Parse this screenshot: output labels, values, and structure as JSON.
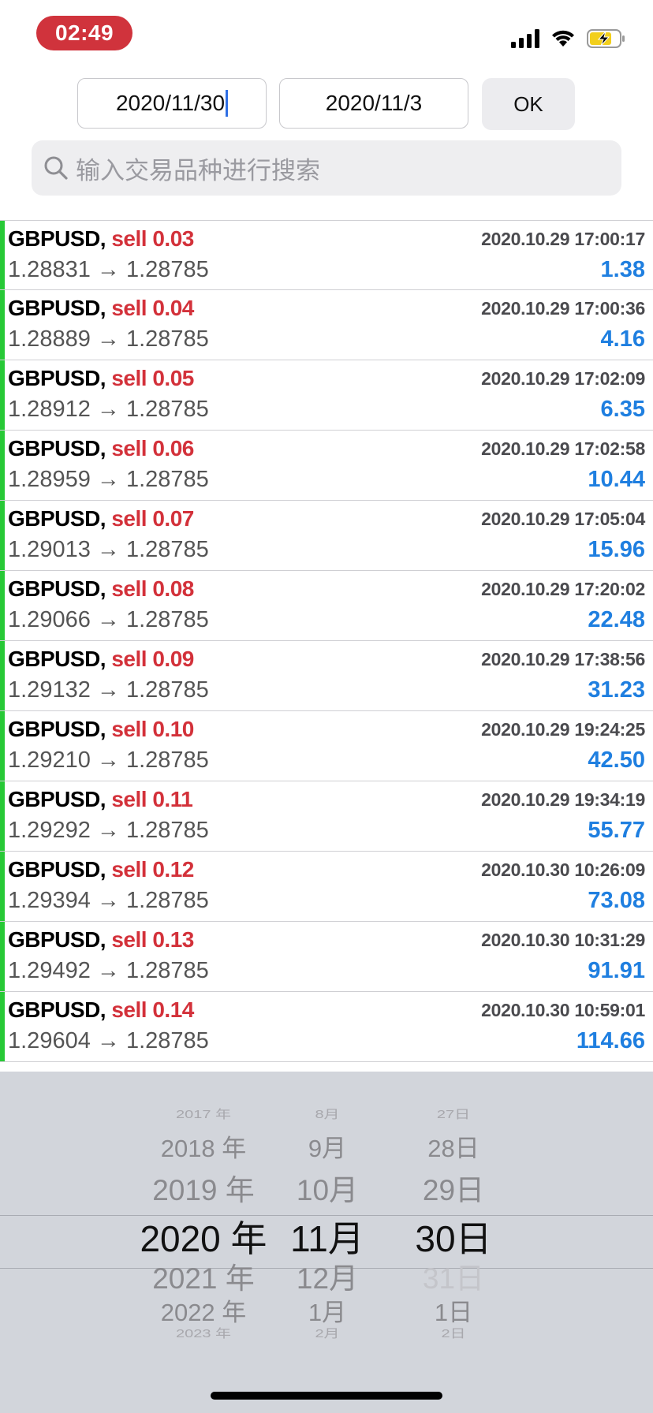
{
  "status_bar": {
    "time": "02:49"
  },
  "filter": {
    "start_date": "2020/11/30",
    "end_date": "2020/11/3",
    "ok_label": "OK",
    "search_placeholder": "输入交易品种进行搜索"
  },
  "trades": [
    {
      "symbol": "GBPUSD,",
      "action": "sell 0.03",
      "prices": "1.28831 → 1.28785",
      "time": "2020.10.29 17:00:17",
      "profit": "1.38"
    },
    {
      "symbol": "GBPUSD,",
      "action": "sell 0.04",
      "prices": "1.28889 → 1.28785",
      "time": "2020.10.29 17:00:36",
      "profit": "4.16"
    },
    {
      "symbol": "GBPUSD,",
      "action": "sell 0.05",
      "prices": "1.28912 → 1.28785",
      "time": "2020.10.29 17:02:09",
      "profit": "6.35"
    },
    {
      "symbol": "GBPUSD,",
      "action": "sell 0.06",
      "prices": "1.28959 → 1.28785",
      "time": "2020.10.29 17:02:58",
      "profit": "10.44"
    },
    {
      "symbol": "GBPUSD,",
      "action": "sell 0.07",
      "prices": "1.29013 → 1.28785",
      "time": "2020.10.29 17:05:04",
      "profit": "15.96"
    },
    {
      "symbol": "GBPUSD,",
      "action": "sell 0.08",
      "prices": "1.29066 → 1.28785",
      "time": "2020.10.29 17:20:02",
      "profit": "22.48"
    },
    {
      "symbol": "GBPUSD,",
      "action": "sell 0.09",
      "prices": "1.29132 → 1.28785",
      "time": "2020.10.29 17:38:56",
      "profit": "31.23"
    },
    {
      "symbol": "GBPUSD,",
      "action": "sell 0.10",
      "prices": "1.29210 → 1.28785",
      "time": "2020.10.29 19:24:25",
      "profit": "42.50"
    },
    {
      "symbol": "GBPUSD,",
      "action": "sell 0.11",
      "prices": "1.29292 → 1.28785",
      "time": "2020.10.29 19:34:19",
      "profit": "55.77"
    },
    {
      "symbol": "GBPUSD,",
      "action": "sell 0.12",
      "prices": "1.29394 → 1.28785",
      "time": "2020.10.30 10:26:09",
      "profit": "73.08"
    },
    {
      "symbol": "GBPUSD,",
      "action": "sell 0.13",
      "prices": "1.29492 → 1.28785",
      "time": "2020.10.30 10:31:29",
      "profit": "91.91"
    },
    {
      "symbol": "GBPUSD,",
      "action": "sell 0.14",
      "prices": "1.29604 → 1.28785",
      "time": "2020.10.30 10:59:01",
      "profit": "114.66"
    }
  ],
  "date_picker": {
    "years": [
      "2017 年",
      "2018 年",
      "2019 年",
      "2020 年",
      "2021 年",
      "2022 年",
      "2023 年"
    ],
    "months": [
      "8月",
      "9月",
      "10月",
      "11月",
      "12月",
      "1月",
      "2月"
    ],
    "days": [
      "27日",
      "28日",
      "29日",
      "30日",
      "31日",
      "1日",
      "2日"
    ],
    "selected_index": 3
  },
  "colors": {
    "time_pill": "#d0333c",
    "sell": "#d3313a",
    "profit": "#1f7fe0",
    "row_bar": "#27c936",
    "picker_bg": "#d2d5db"
  }
}
